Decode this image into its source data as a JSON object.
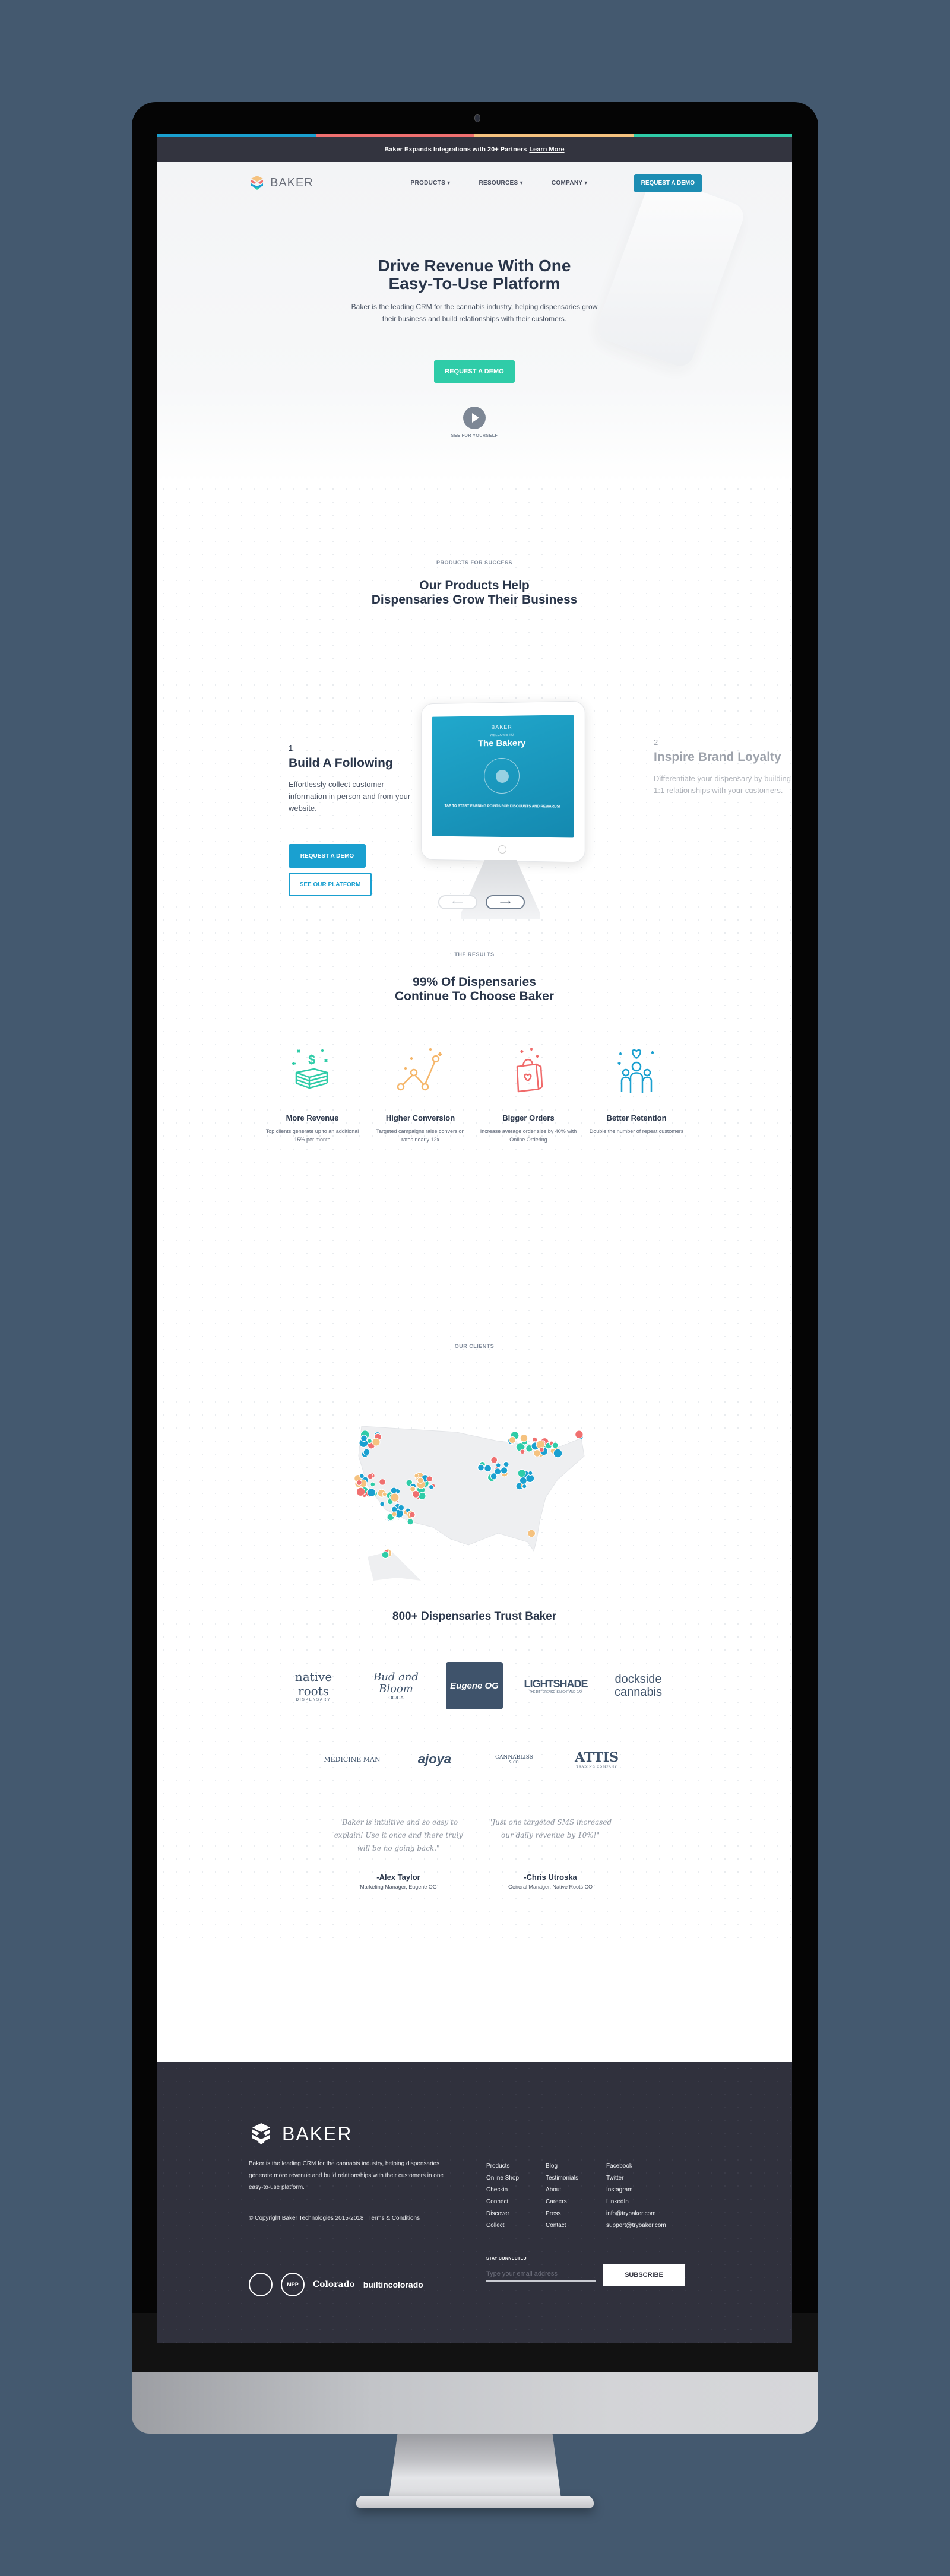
{
  "colors": {
    "bar": [
      "#1aa0d0",
      "#f07070",
      "#f5c27f",
      "#2fcca8"
    ],
    "accent_teal": "#2fcca8",
    "accent_blue": "#1aa0d0",
    "dark_text": "#2a364a",
    "footer_bg": "#30313d",
    "page_bg": "#44596f"
  },
  "announcement": {
    "text": "Baker Expands Integrations with 20+ Partners",
    "link": "Learn More"
  },
  "nav": {
    "logo_text": "BAKER",
    "logo_icon": "baker-logo-icon",
    "items": [
      {
        "label": "PRODUCTS ▾"
      },
      {
        "label": "RESOURCES ▾"
      },
      {
        "label": "COMPANY ▾"
      }
    ],
    "cta": "REQUEST A DEMO"
  },
  "hero": {
    "title_line1": "Drive Revenue With One",
    "title_line2": "Easy-To-Use Platform",
    "subtitle_line1": "Baker is the leading CRM for the cannabis industry, helping dispensaries grow",
    "subtitle_line2": "their business and build relationships with their customers.",
    "cta": "REQUEST A DEMO",
    "video_label": "SEE FOR YOURSELF",
    "video_icon": "play-icon"
  },
  "products": {
    "eyebrow": "PRODUCTS FOR SUCCESS",
    "title_line1": "Our Products Help",
    "title_line2": "Dispensaries Grow Their Business",
    "slides": [
      {
        "number": "1",
        "title": "Build A Following",
        "text": "Effortlessly collect customer information in person and from your website.",
        "primary_cta": "REQUEST A DEMO",
        "secondary_cta": "SEE OUR PLATFORM"
      },
      {
        "number": "2",
        "title": "Inspire Brand Loyalty",
        "text": "Differentiate your dispensary by building 1:1 relationships with your customers."
      }
    ],
    "tablet": {
      "brand": "BAKER",
      "welcome": "WELCOME TO",
      "title": "The Bakery",
      "cta": "TAP TO START EARNING POINTS FOR DISCOUNTS AND REWARDS!"
    },
    "prev_label": "⟵",
    "next_label": "⟶"
  },
  "results": {
    "eyebrow": "THE RESULTS",
    "title_line1": "99% Of Dispensaries",
    "title_line2": "Continue To Choose Baker",
    "features": [
      {
        "icon": "money-stack-icon",
        "title": "More Revenue",
        "text": "Top clients generate up to an additional 15% per month",
        "color": "#2fcca8"
      },
      {
        "icon": "line-graph-icon",
        "title": "Higher Conversion",
        "text": "Targeted campaigns raise conversion rates nearly 12x",
        "color": "#f5b66a"
      },
      {
        "icon": "shopping-bag-icon",
        "title": "Bigger Orders",
        "text": "Increase average order size by 40% with Online Ordering",
        "color": "#f06a6a"
      },
      {
        "icon": "people-heart-icon",
        "title": "Better Retention",
        "text": "Double the number of repeat customers",
        "color": "#1aa0d0"
      }
    ]
  },
  "clients": {
    "eyebrow": "OUR CLIENTS",
    "trust_title": "800+ Dispensaries Trust Baker",
    "logos_row1": [
      {
        "name": "native roots",
        "sub": "DISPENSARY"
      },
      {
        "name": "Bud and Bloom",
        "sub": "OC/CA"
      },
      {
        "name": "Eugene OG",
        "sub": ""
      },
      {
        "name": "LIGHTSHADE",
        "sub": "THE DIFFERENCE IS NIGHT AND DAY"
      },
      {
        "name": "dockside cannabis",
        "sub": ""
      }
    ],
    "logos_row2": [
      {
        "name": "MEDICINE MAN",
        "sub": ""
      },
      {
        "name": "ajoya",
        "sub": ""
      },
      {
        "name": "CANNABLISS",
        "sub": "& CO."
      },
      {
        "name": "ATTIS",
        "sub": "TRADING COMPANY"
      }
    ],
    "testimonials": [
      {
        "quote": "\"Baker is intuitive and so easy to explain! Use it once and there truly will be no going back.\"",
        "name": "-Alex Taylor",
        "role": "Marketing Manager, Eugene OG"
      },
      {
        "quote": "\"Just one targeted SMS increased our daily revenue by 10%!\"",
        "name": "-Chris Utroska",
        "role": "General Manager, Native Roots CO"
      }
    ]
  },
  "footer": {
    "logo_text": "BAKER",
    "description": "Baker is the leading CRM for the cannabis industry, helping dispensaries generate more revenue and build relationships with their customers in one easy-to-use platform.",
    "copyright": "© Copyright Baker Technologies 2015-2018 | Terms & Conditions",
    "col1": [
      "Products",
      "Online Shop",
      "Checkin",
      "Connect",
      "Discover",
      "Collect"
    ],
    "col2": [
      "Blog",
      "Testimonials",
      "About",
      "Careers",
      "Press",
      "Contact"
    ],
    "col3": [
      "Facebook",
      "Twitter",
      "Instagram",
      "LinkedIn",
      "info@trybaker.com",
      "support@trybaker.com"
    ],
    "stay_connected": "STAY CONNECTED",
    "email_placeholder": "Type your email address",
    "subscribe": "SUBSCRIBE",
    "badges": [
      "badge-seal",
      "MPP",
      "Colorado",
      "builtincolorado"
    ]
  }
}
